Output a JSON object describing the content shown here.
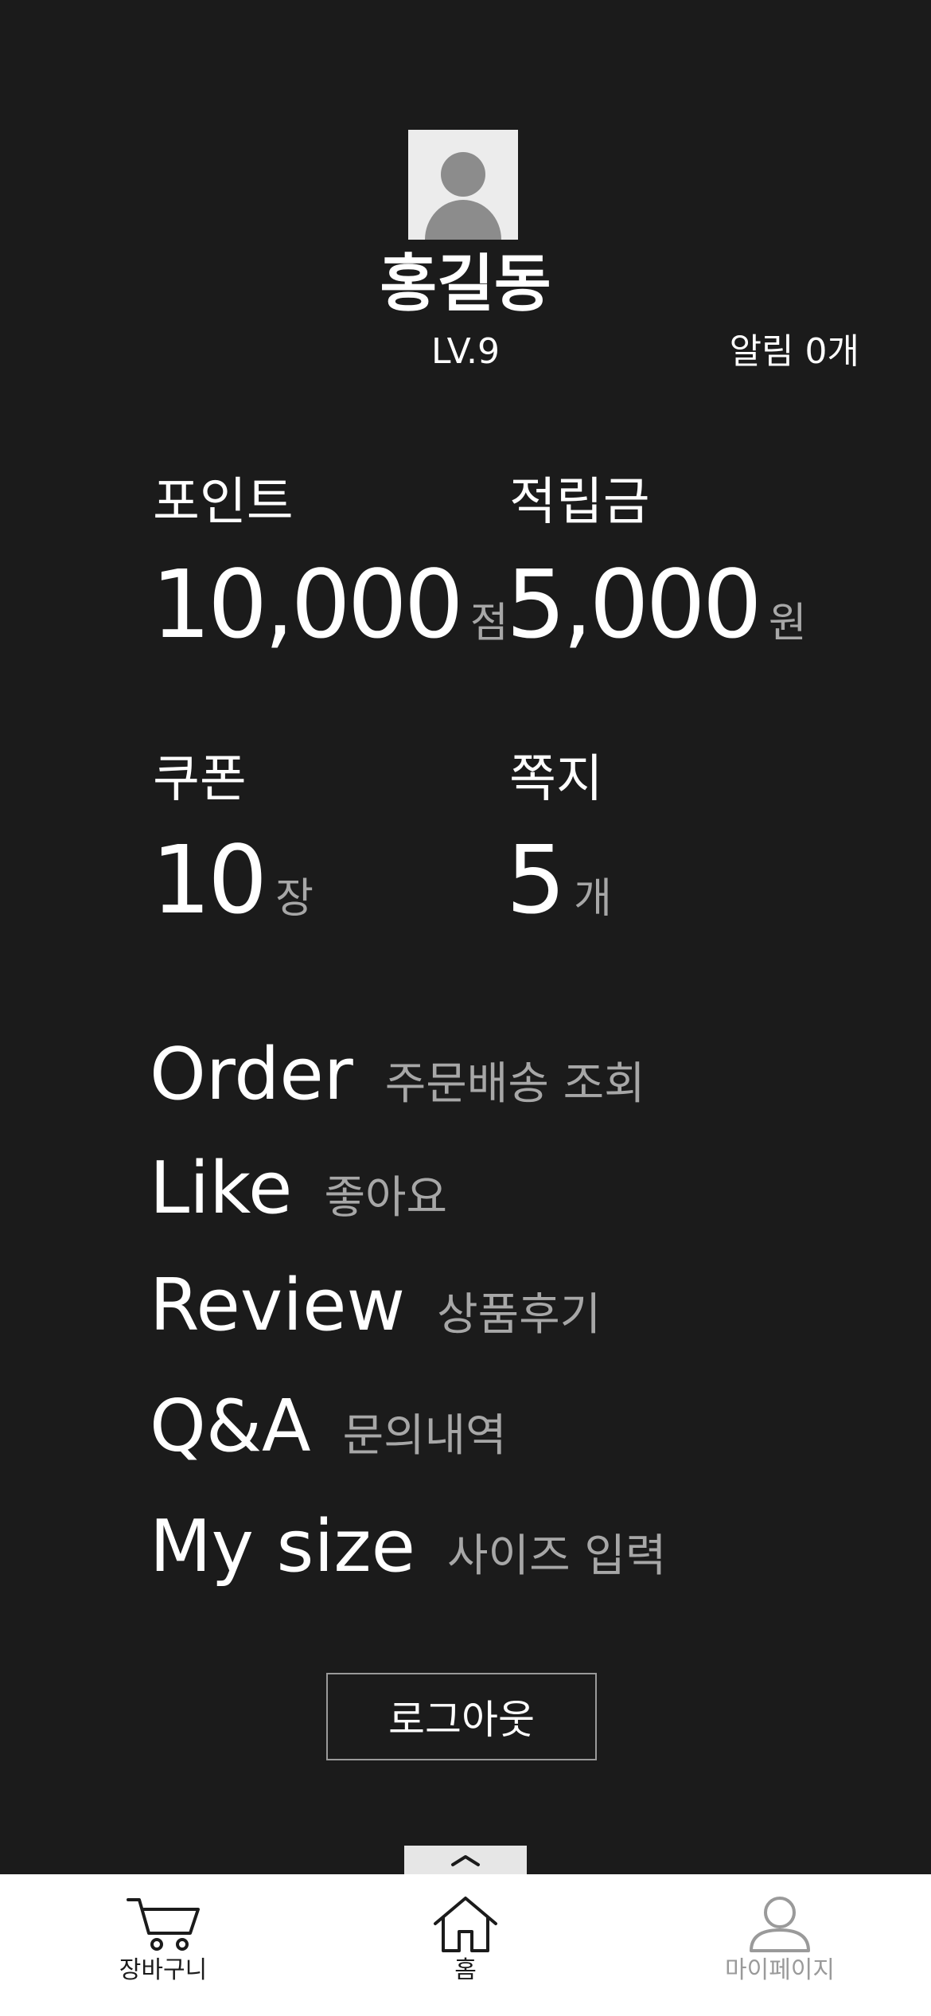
{
  "profile": {
    "name": "홍길동",
    "level": "LV.9",
    "notifications": "알림 0개"
  },
  "stats": [
    {
      "label": "포인트",
      "value": "10,000",
      "unit": "점"
    },
    {
      "label": "적립금",
      "value": "5,000",
      "unit": "원"
    },
    {
      "label": "쿠폰",
      "value": "10",
      "unit": "장"
    },
    {
      "label": "쪽지",
      "value": "5",
      "unit": "개"
    }
  ],
  "menu": [
    {
      "en": "Order",
      "ko": "주문배송 조회"
    },
    {
      "en": "Like",
      "ko": "좋아요"
    },
    {
      "en": "Review",
      "ko": "상품후기"
    },
    {
      "en": "Q&A",
      "ko": "문의내역"
    },
    {
      "en": "My size",
      "ko": "사이즈 입력"
    }
  ],
  "logout_label": "로그아웃",
  "bottom_nav": [
    {
      "label": "장바구니",
      "icon": "cart-icon"
    },
    {
      "label": "홈",
      "icon": "home-icon"
    },
    {
      "label": "마이페이지",
      "icon": "user-icon"
    }
  ],
  "colors": {
    "background": "#1b1b1b",
    "text": "#ffffff",
    "muted": "#a7a7a7",
    "nav_background": "#ffffff",
    "nav_inactive": "#9a9a9a"
  }
}
